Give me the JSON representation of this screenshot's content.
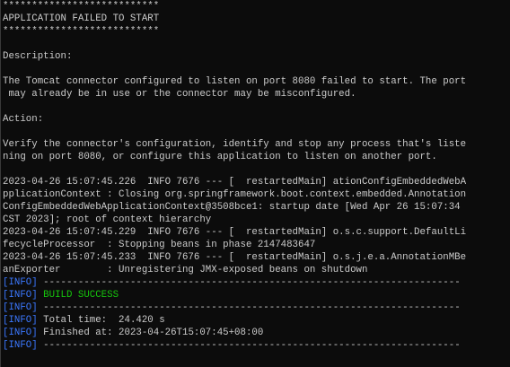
{
  "colors": {
    "text": "#cccccc",
    "background": "#0c0c0c",
    "info_tag": "#3b78ff",
    "success": "#16c60c"
  },
  "lines": [
    "***************************",
    "APPLICATION FAILED TO START",
    "***************************",
    "",
    "Description:",
    "",
    "The Tomcat connector configured to listen on port 8080 failed to start. The port",
    " may already be in use or the connector may be misconfigured.",
    "",
    "Action:",
    "",
    "Verify the connector's configuration, identify and stop any process that's liste",
    "ning on port 8080, or configure this application to listen on another port.",
    "",
    "2023-04-26 15:07:45.226  INFO 7676 --- [  restartedMain] ationConfigEmbeddedWebA",
    "pplicationContext : Closing org.springframework.boot.context.embedded.Annotation",
    "ConfigEmbeddedWebApplicationContext@3508bce1: startup date [Wed Apr 26 15:07:34",
    "CST 2023]; root of context hierarchy",
    "2023-04-26 15:07:45.229  INFO 7676 --- [  restartedMain] o.s.c.support.DefaultLi",
    "fecycleProcessor  : Stopping beans in phase 2147483647",
    "2023-04-26 15:07:45.233  INFO 7676 --- [  restartedMain] o.s.j.e.a.AnnotationMBe",
    "anExporter        : Unregistering JMX-exposed beans on shutdown"
  ],
  "maven": {
    "tag": "[INFO]",
    "separator": "------------------------------------------------------------------------",
    "build_success": "BUILD SUCCESS",
    "total_time": "Total time:  24.420 s",
    "finished_at": "Finished at: 2023-04-26T15:07:45+08:00"
  }
}
